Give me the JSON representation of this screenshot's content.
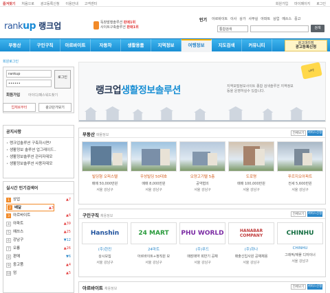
{
  "topbar": {
    "left": [
      "즐겨찾기",
      "처음으로",
      "광고등록신청",
      "이용안내",
      "고객센터"
    ],
    "right": [
      "회원가입",
      "마이페이지",
      "로그인"
    ]
  },
  "logo": {
    "en": "rank",
    "en_mark": "up",
    "ko": "랭크업"
  },
  "promo": {
    "line1_pre": "독창발행솔루션 ",
    "line1_hot": "판매1위",
    "line2_pre": "사이트구축솔루션 ",
    "line2_hot": "판매1위"
  },
  "popular": {
    "label": "인기",
    "items": [
      "아르바이트",
      "이사",
      "상가",
      "사무실",
      "아파트",
      "상업",
      "예쓰스",
      "중고"
    ]
  },
  "search": {
    "select": "통합검색",
    "button": "검색"
  },
  "nav": {
    "items": [
      "부동산",
      "구인구직",
      "아르바이트",
      "자동차",
      "생활용품",
      "지역정보",
      "여행정보",
      "지도검색",
      "커뮤니티"
    ],
    "ad_line1": "광고대리점",
    "ad_line2": "광고등록신청"
  },
  "login": {
    "title": "회원로그인",
    "id": "rankup",
    "pw": "••••••",
    "btn": "로그인",
    "signup": "회원가입",
    "forgot": "아이디/패스워드찾기",
    "btn1": "업체로부터",
    "btn2": "광고단가보기"
  },
  "notice": {
    "title": "공지사항",
    "items": [
      "랭크업솔루션 구축하시면?",
      "생활정보 솔루션 업그레이드..",
      "생활정보솔루션 관리자데모",
      "생활정보솔루션 사용자데모"
    ]
  },
  "rank": {
    "title": "실시간 인기검색어",
    "items": [
      {
        "n": "1",
        "name": "상업",
        "chg": "7",
        "dir": "up"
      },
      {
        "n": "2",
        "name": "배달",
        "chg": "3",
        "dir": "up"
      },
      {
        "n": "3",
        "name": "아르바이트",
        "chg": "6",
        "dir": "up"
      },
      {
        "n": "4",
        "name": "아파트",
        "chg": "39",
        "dir": "up"
      },
      {
        "n": "5",
        "name": "예쓰스",
        "chg": "25",
        "dir": "up"
      },
      {
        "n": "6",
        "name": "강남구",
        "chg": "12",
        "dir": "dn"
      },
      {
        "n": "7",
        "name": "오룡",
        "chg": "26",
        "dir": "up"
      },
      {
        "n": "8",
        "name": "판매",
        "chg": "6",
        "dir": "dn"
      },
      {
        "n": "9",
        "name": "중고품",
        "chg": "4",
        "dir": "up"
      },
      {
        "n": "10",
        "name": "엄",
        "chg": "5",
        "dir": "up"
      }
    ]
  },
  "hero": {
    "title_pre": "랭크업",
    "title_hl": "생활정보솔루션",
    "desc": "지역포털정보사이트 종합 검색솔루션 지역정보 등을 운영하실수 있습니다.",
    "badge": "LIFE"
  },
  "realestate": {
    "title": "부동산",
    "sub": "매물정보",
    "all": "전체보기",
    "svc": "서비스신청",
    "cards": [
      {
        "l1": "빌딩형 오피스텔",
        "l2": "매매 50,000만원",
        "l3": "서울 강남구"
      },
      {
        "l1": "우성빌딩 50대호",
        "l2": "매매 8,000만원",
        "l3": "서울 강남구"
      },
      {
        "l1": "오양고기텔 5층",
        "l2": "공약협의",
        "l3": "서울 강남구"
      },
      {
        "l1": "도로명",
        "l2": "매매 100,000만원",
        "l3": "서울 강남구"
      },
      {
        "l1": "푸르지오아파트",
        "l2": "전세 5,600만원",
        "l3": "서울 강남구"
      }
    ]
  },
  "jobs": {
    "title": "구인구직",
    "sub": "채용정보",
    "all": "전체보기",
    "svc": "서비스신청",
    "cards": [
      {
        "logo": "Hanshin",
        "l1": "(주)한진",
        "l2": "상시모집",
        "l3": "서울 강남구"
      },
      {
        "logo": "24 MART",
        "l1": "24마트",
        "l2": "아르바이트+정직원 모",
        "l3": "서울 강남구"
      },
      {
        "logo": "PHU WORLD",
        "l1": "(주)푸드",
        "l2": "매장매약 회반기 공채",
        "l3": "서울 강남구"
      },
      {
        "logo": "HANABAR COMPANY",
        "l1": "(주)하나",
        "l2": "매출신입사원 공채채용",
        "l3": "서울 강남구"
      },
      {
        "logo": "CHINHU",
        "l1": "CHINHU",
        "l2": "그래픽/애플 디자이너",
        "l3": "서울 강남구"
      }
    ]
  },
  "parttime": {
    "title": "아르바이트",
    "sub": "채용정보",
    "all": "전체보기",
    "svc": "서비스신청"
  }
}
